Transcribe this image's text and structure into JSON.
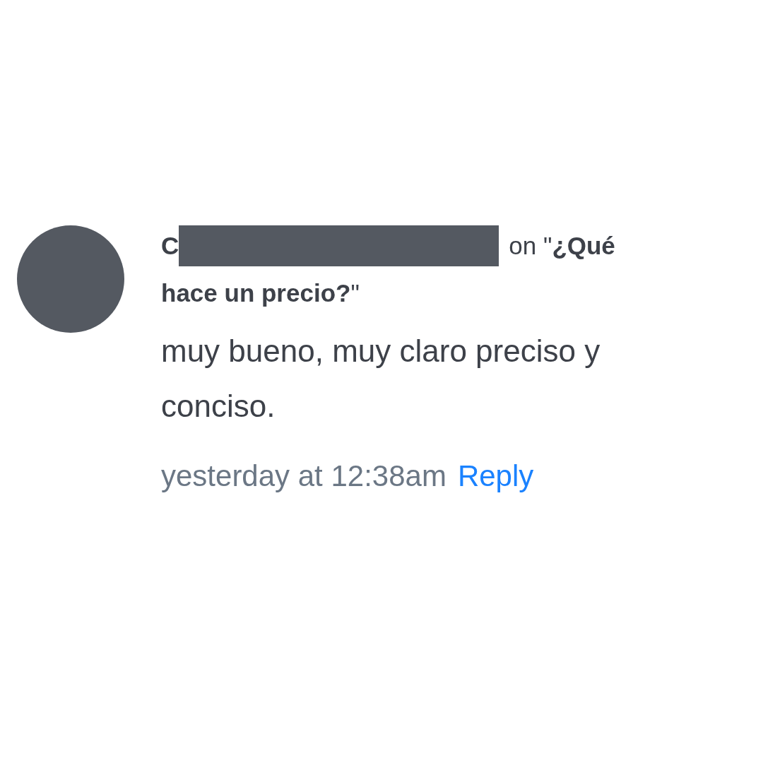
{
  "comment": {
    "author": "C",
    "author_redacted": true,
    "context_lines": [
      "on \"**¿Qué**",
      "**hace un precio?**\""
    ],
    "body": "muy bueno, muy claro preciso y conciso.",
    "time": "yesterday at 12:38am",
    "reply": "Reply"
  }
}
